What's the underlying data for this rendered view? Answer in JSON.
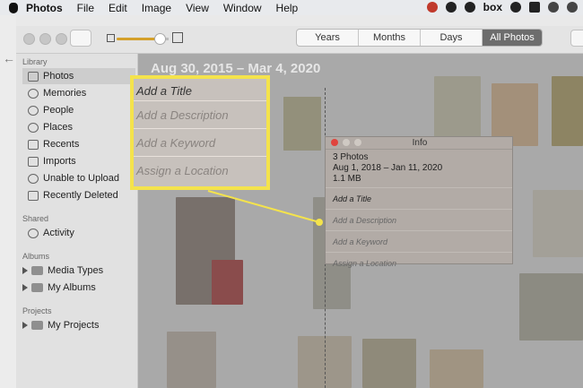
{
  "menubar": {
    "app_name": "Photos",
    "items": [
      "File",
      "Edit",
      "Image",
      "View",
      "Window",
      "Help"
    ],
    "status_box": "box",
    "status_icons": [
      "creative-cloud-icon",
      "cloud-icon",
      "sync-icon",
      "box-icon",
      "record-icon",
      "airplay-icon",
      "wifi-icon",
      "volume-icon"
    ]
  },
  "toolbar": {
    "view_tabs": [
      "Years",
      "Months",
      "Days",
      "All Photos"
    ],
    "active_tab": "All Photos",
    "zoom_level": 0.7
  },
  "sidebar": {
    "library_header": "Library",
    "library_items": [
      "Photos",
      "Memories",
      "People",
      "Places",
      "Recents",
      "Imports",
      "Unable to Upload",
      "Recently Deleted"
    ],
    "shared_header": "Shared",
    "shared_items": [
      "Activity"
    ],
    "albums_header": "Albums",
    "album_items": [
      "Media Types",
      "My Albums"
    ],
    "projects_header": "Projects",
    "project_items": [
      "My Projects"
    ]
  },
  "main": {
    "date_range": "Aug 30, 2015 – Mar 4, 2020"
  },
  "callout": {
    "fields": [
      "Add a Title",
      "Add a Description",
      "Add a Keyword",
      "Assign a Location"
    ],
    "highlight_color": "#f4e34c"
  },
  "info_panel": {
    "title": "Info",
    "count": "3 Photos",
    "date_range": "Aug 1, 2018 – Jan 11, 2020",
    "size": "1.1 MB",
    "fields": [
      "Add a Title",
      "Add a Description",
      "Add a Keyword",
      "Assign a Location"
    ]
  }
}
